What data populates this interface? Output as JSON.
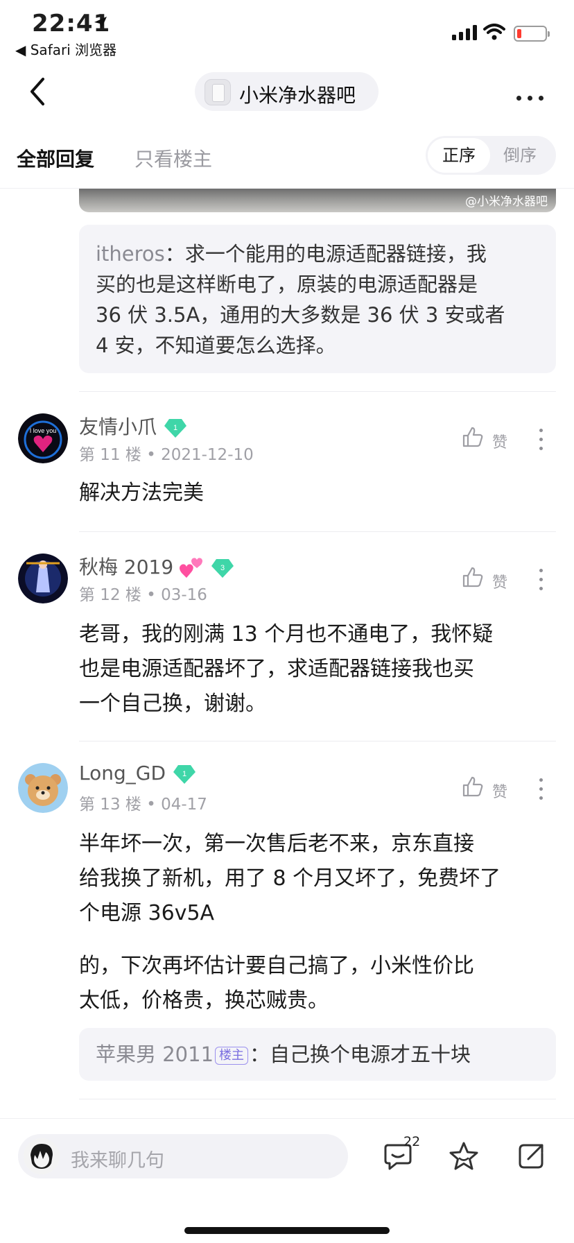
{
  "status_bar": {
    "time": "22:41",
    "back_app": "◀ Safari 浏览器"
  },
  "nav": {
    "forum_name": "小米净水器吧"
  },
  "filter": {
    "all_replies": "全部回复",
    "owner_only": "只看楼主",
    "sort_asc": "正序",
    "sort_desc": "倒序"
  },
  "top_image": {
    "watermark": "@小米净水器吧"
  },
  "quote": {
    "user": "itheros",
    "sep": "：",
    "lines": [
      "求一个能用的电源适配器链接，我",
      "买的也是这样断电了，原装的电源适配器是",
      "36 伏 3.5A，通用的大多数是 36 伏 3 安或者",
      "4 安，不知道要怎么选择。"
    ]
  },
  "posts": [
    {
      "username": "友情小爪",
      "level": "1",
      "floor": "第 11 楼",
      "date": "2021-12-10",
      "like_label": "赞",
      "body": [
        "解决方法完美"
      ]
    },
    {
      "username": "秋梅 2019",
      "level": "3",
      "floor": "第 12 楼",
      "date": "03-16",
      "like_label": "赞",
      "body": [
        "老哥，我的刚满 13 个月也不通电了，我怀疑",
        "也是电源适配器坏了，求适配器链接我也买",
        "一个自己换，谢谢。"
      ]
    },
    {
      "username": "Long_GD",
      "level": "1",
      "floor": "第 13 楼",
      "date": "04-17",
      "like_label": "赞",
      "body": [
        "半年坏一次，第一次售后老不来，京东直接",
        "给我换了新机，用了 8 个月又坏了，免费坏了",
        "个电源 36v5A"
      ],
      "body2": [
        "的，下次再坏估计要自己搞了，小米性价比",
        "太低，价格贵，换芯贼贵。"
      ]
    }
  ],
  "sub_reply": {
    "user": "苹果男 2011",
    "tag": "楼主",
    "sep": "：",
    "text": "自己换个电源才五十块"
  },
  "bottom_bar": {
    "placeholder": "我来聊几句",
    "comment_count": "22"
  },
  "colors": {
    "accent_purple": "#7b6fe0",
    "level_badge": "#3fd6a8",
    "battery_low": "#ff3b30"
  }
}
